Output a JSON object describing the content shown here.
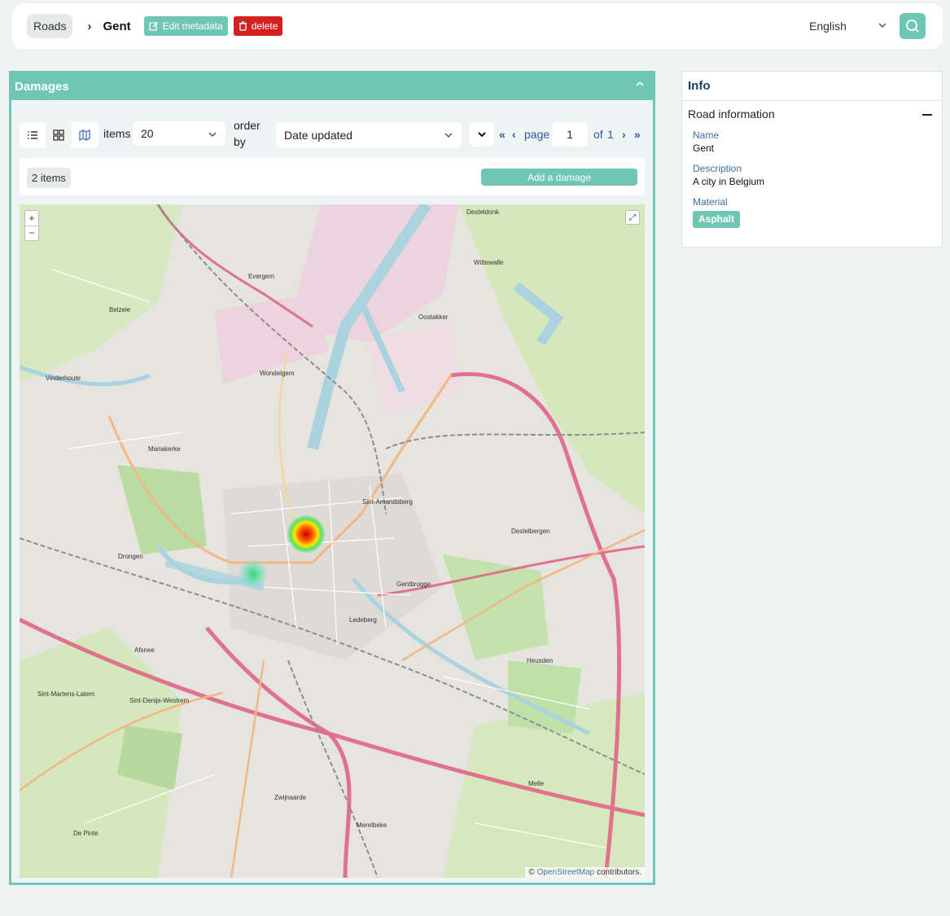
{
  "breadcrumb": {
    "root": "Roads",
    "current": "Gent"
  },
  "actions": {
    "edit_label": "Edit metadata",
    "delete_label": "delete"
  },
  "language": {
    "selected": "English"
  },
  "damages": {
    "title": "Damages",
    "items_label": "items",
    "items_per_page": "20",
    "order_label_1": "order",
    "order_label_2": "by",
    "order_value": "Date updated",
    "pager": {
      "first": "«",
      "prev": "‹",
      "page_label": "page",
      "page": "1",
      "of_label": "of",
      "total": "1",
      "next": "›",
      "last": "»"
    },
    "count": "2 items",
    "add_label": "Add a damage"
  },
  "map": {
    "zoom_in": "+",
    "zoom_out": "−",
    "fullscreen": "⤢",
    "attribution_copyright": "© ",
    "attribution_link": "OpenStreetMap",
    "attribution_suffix": " contributors.",
    "places": {
      "evergem": "Evergem",
      "belzele": "Belzele",
      "oostakker": "Oostakker",
      "wondelgem": "Wondelgem",
      "mariakerke": "Mariakerke",
      "vinderhoute": "Vinderhoute",
      "drongen": "Drongen",
      "sint_amandsberg": "Sint-Amandsberg",
      "destelbergen": "Destelbergen",
      "gentbrugge": "Gentbrugge",
      "ledeberg": "Ledeberg",
      "afsnee": "Afsnee",
      "sint_martens_latem": "Sint-Martens-Latem",
      "sint_denijs_westrem": "Sint-Denijs-Westrem",
      "zwijnaarde": "Zwijnaarde",
      "de_pinte": "De Pinte",
      "merelbeke": "Merelbeke",
      "melle": "Melle",
      "heusden": "Heusden",
      "wittewalle": "Wittewalle",
      "desteldonk": "Desteldonk"
    }
  },
  "info": {
    "title": "Info",
    "section": "Road information",
    "name_label": "Name",
    "name_value": "Gent",
    "desc_label": "Description",
    "desc_value": "A city in Belgium",
    "material_label": "Material",
    "material_value": "Asphalt"
  },
  "colors": {
    "accent": "#6fc6b4",
    "danger": "#d32020",
    "link": "#2c5aa0"
  }
}
